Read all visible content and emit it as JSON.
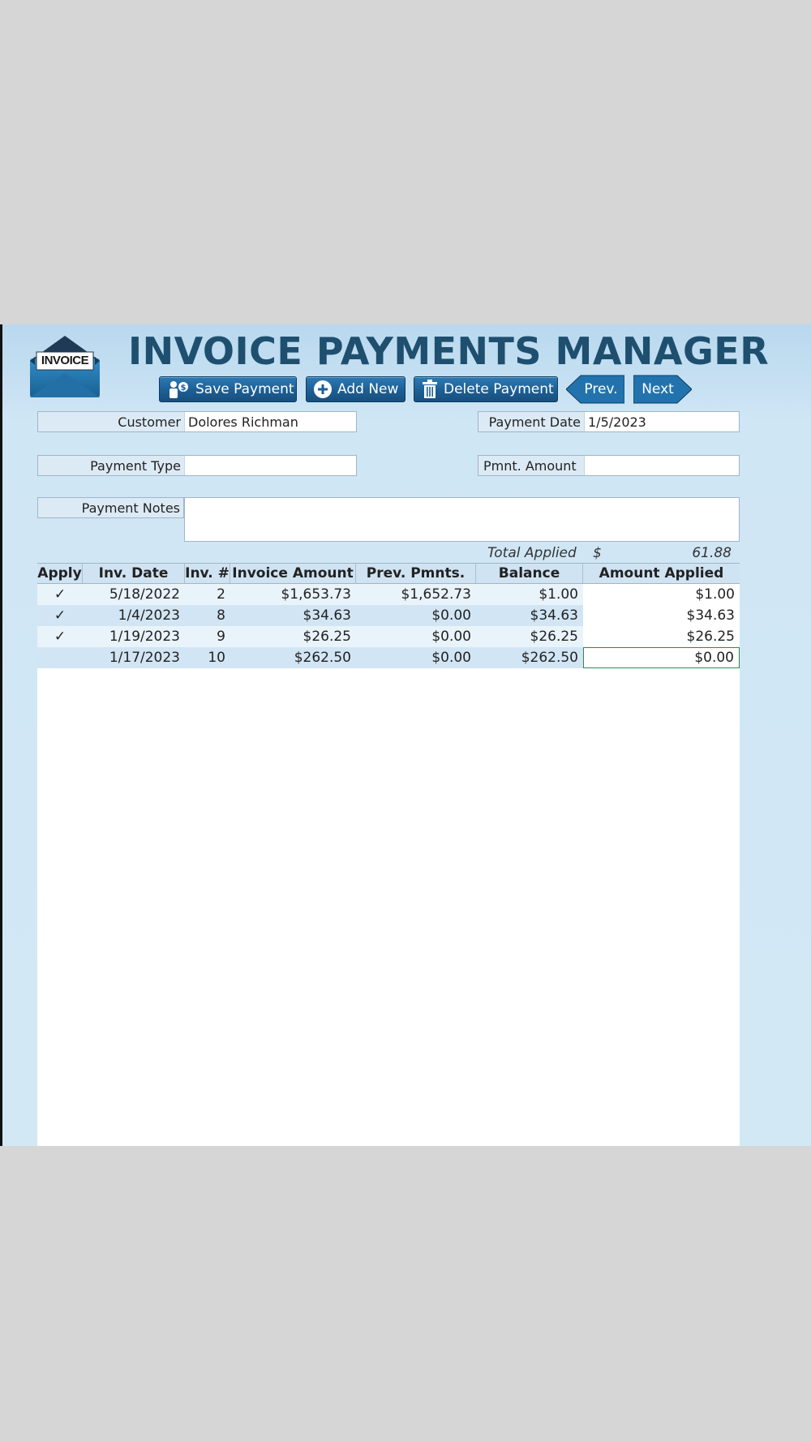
{
  "app": {
    "logo_text": "INVOICE",
    "title": "INVOICE PAYMENTS MANAGER"
  },
  "toolbar": {
    "save_label": "Save Payment",
    "add_label": "Add New",
    "delete_label": "Delete Payment",
    "prev_label": "Prev.",
    "next_label": "Next"
  },
  "form": {
    "customer_label": "Customer",
    "customer_value": "Dolores Richman",
    "payment_date_label": "Payment Date",
    "payment_date_value": "1/5/2023",
    "payment_type_label": "Payment Type",
    "payment_type_value": "",
    "pmnt_amount_label": "Pmnt. Amount",
    "pmnt_amount_value": "",
    "notes_label": "Payment Notes",
    "notes_value": ""
  },
  "totals": {
    "label": "Total Applied",
    "currency": "$",
    "value": "61.88"
  },
  "table": {
    "headers": [
      "Apply",
      "Inv. Date",
      "Inv. #",
      "Invoice Amount",
      "Prev. Pmnts.",
      "Balance",
      "Amount Applied"
    ],
    "rows": [
      {
        "apply": "✓",
        "date": "5/18/2022",
        "num": "2",
        "amount": "$1,653.73",
        "prev": "$1,652.73",
        "balance": "$1.00",
        "applied": "$1.00"
      },
      {
        "apply": "✓",
        "date": "1/4/2023",
        "num": "8",
        "amount": "$34.63",
        "prev": "$0.00",
        "balance": "$34.63",
        "applied": "$34.63"
      },
      {
        "apply": "✓",
        "date": "1/19/2023",
        "num": "9",
        "amount": "$26.25",
        "prev": "$0.00",
        "balance": "$26.25",
        "applied": "$26.25"
      },
      {
        "apply": "",
        "date": "1/17/2023",
        "num": "10",
        "amount": "$262.50",
        "prev": "$0.00",
        "balance": "$262.50",
        "applied": "$0.00"
      }
    ]
  },
  "colors": {
    "title": "#1e4f6f",
    "button": "#1c5f94",
    "active_cell_border": "#2b8a4d"
  }
}
